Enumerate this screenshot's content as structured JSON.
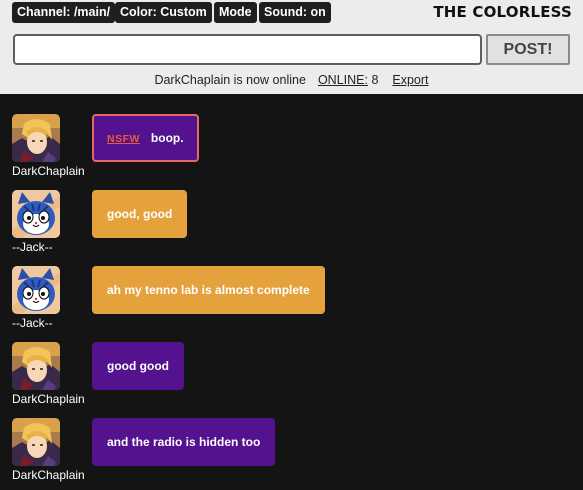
{
  "header": {
    "channel_label": "Channel: /main/",
    "color_label": "Color: Custom",
    "mode_label": "Mode",
    "sound_label": "Sound: on",
    "brand": "THE COLORLESS",
    "message_input": {
      "value": "",
      "placeholder": ""
    },
    "post_label": "POST!",
    "status_text": "DarkChaplain is now online",
    "online_label": "ONLINE:",
    "online_count": "8",
    "export_label": "Export"
  },
  "colors": {
    "header_bg": "#ececec",
    "chat_bg": "#141414",
    "pill_bg": "#1e1e1e",
    "bubble_purple": "#55128e",
    "bubble_orange": "#e5a23c",
    "nsfw_red": "#e85a3c"
  },
  "messages": [
    {
      "user": "DarkChaplain",
      "avatar_icon": "anime-character-avatar-icon",
      "color": "purple",
      "nsfw_tag": "NSFW",
      "text": "boop."
    },
    {
      "user": "--Jack--",
      "avatar_icon": "blue-cat-avatar-icon",
      "color": "orange",
      "text": "good, good"
    },
    {
      "user": "--Jack--",
      "avatar_icon": "blue-cat-avatar-icon",
      "color": "orange",
      "text": "ah my tenno lab is almost complete"
    },
    {
      "user": "DarkChaplain",
      "avatar_icon": "anime-character-avatar-icon",
      "color": "purple",
      "text": "good good"
    },
    {
      "user": "DarkChaplain",
      "avatar_icon": "anime-character-avatar-icon",
      "color": "purple",
      "text": "and the radio is hidden too"
    }
  ]
}
